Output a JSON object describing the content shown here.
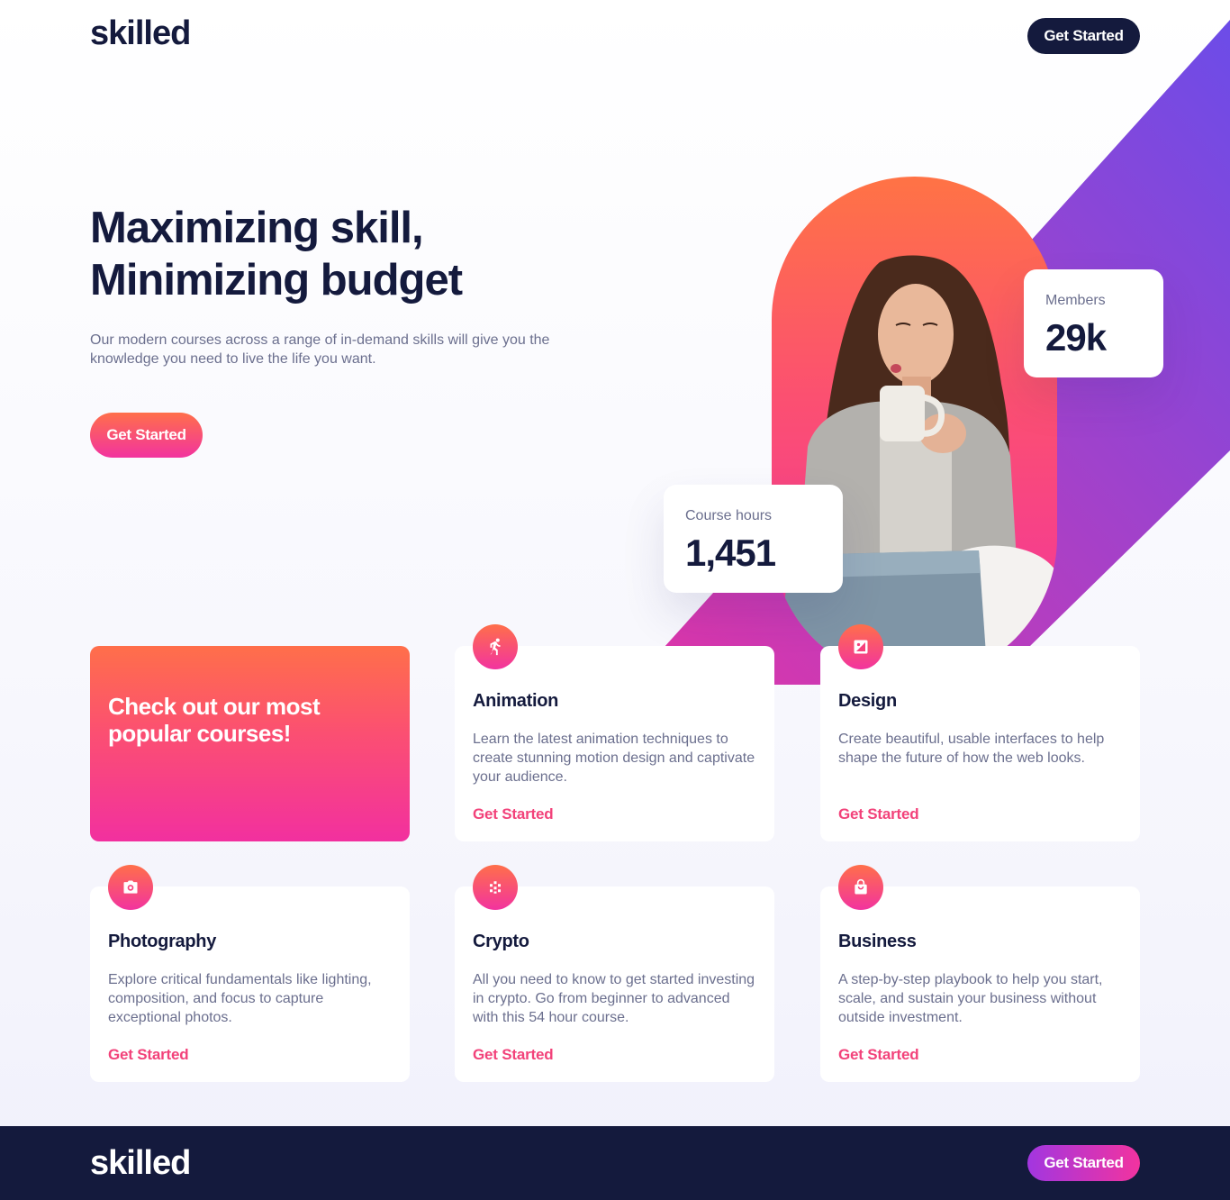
{
  "brand": {
    "logo": "skilled"
  },
  "header": {
    "cta_label": "Get Started"
  },
  "hero": {
    "title_line1": "Maximizing skill,",
    "title_line2": "Minimizing budget",
    "subtitle": "Our modern courses across a range of in-demand skills will give you the knowledge you need to live the life you want.",
    "cta_label": "Get Started"
  },
  "stats": {
    "members": {
      "label": "Members",
      "value": "29k"
    },
    "hours": {
      "label": "Course hours",
      "value": "1,451"
    }
  },
  "promo": {
    "title": "Check out our most popular courses!"
  },
  "courses": [
    {
      "title": "Animation",
      "icon": "running-figure-icon",
      "desc": "Learn the latest animation techniques to create stunning motion design and captivate your audience.",
      "link": "Get Started"
    },
    {
      "title": "Design",
      "icon": "design-image-icon",
      "desc": "Create beautiful, usable interfaces to help shape the future of how the web looks.",
      "link": "Get Started"
    },
    {
      "title": "Photography",
      "icon": "camera-icon",
      "desc": "Explore critical fundamentals like lighting, composition, and focus to capture exceptional photos.",
      "link": "Get Started"
    },
    {
      "title": "Crypto",
      "icon": "crypto-dots-icon",
      "desc": "All you need to know to get started investing in crypto. Go from beginner to advanced with this 54 hour course.",
      "link": "Get Started"
    },
    {
      "title": "Business",
      "icon": "shopping-bag-icon",
      "desc": "A step-by-step playbook to help you start, scale, and sustain your business without outside investment.",
      "link": "Get Started"
    }
  ],
  "footer": {
    "logo": "skilled",
    "cta_label": "Get Started"
  },
  "colors": {
    "navy": "#141a3d",
    "accent_orange": "#ff6f4a",
    "accent_pink": "#f2339f",
    "accent_purple": "#6c4ce8",
    "link_pink": "#f2427a",
    "text_muted": "#6b6f8e"
  }
}
